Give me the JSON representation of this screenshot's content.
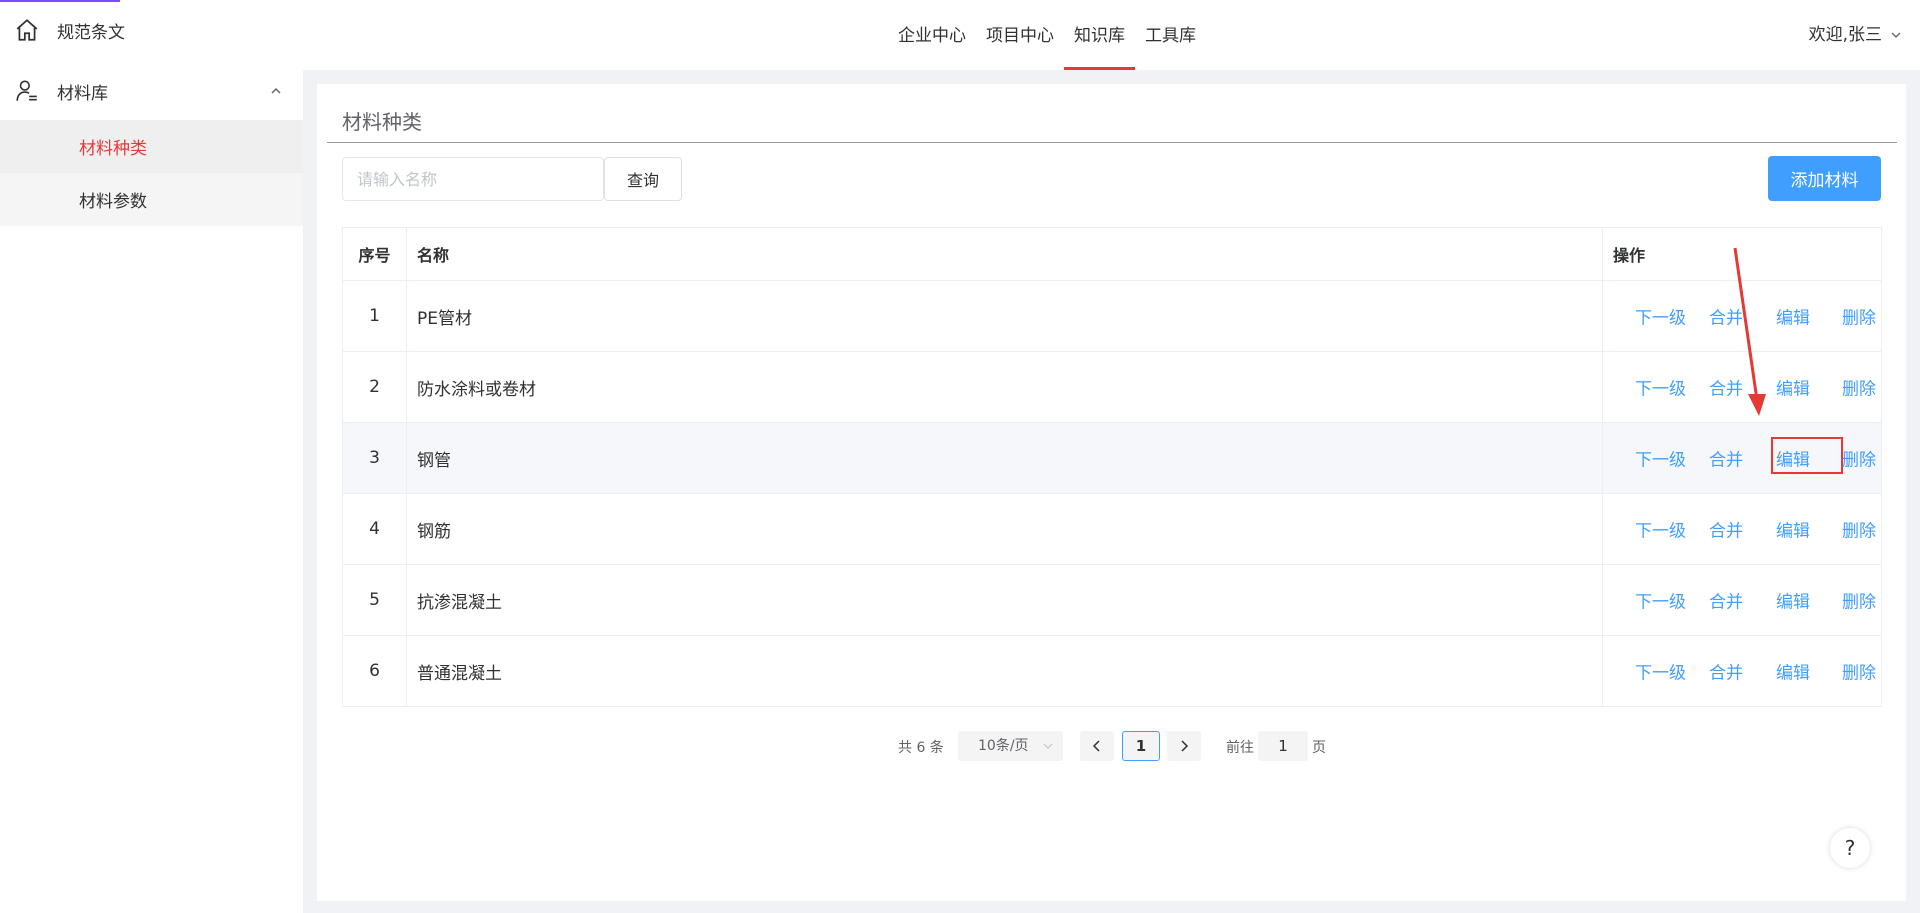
{
  "topnav": {
    "items": [
      {
        "label": "企业中心",
        "active": false
      },
      {
        "label": "项目中心",
        "active": false
      },
      {
        "label": "知识库",
        "active": true
      },
      {
        "label": "工具库",
        "active": false
      }
    ],
    "active_color": "#e4393c"
  },
  "user": {
    "greeting": "欢迎,张三"
  },
  "sidebar": {
    "items": [
      {
        "label": "规范条文",
        "icon": "home-icon"
      },
      {
        "label": "材料库",
        "icon": "user-list-icon",
        "expanded": true,
        "children": [
          {
            "label": "材料种类",
            "active": true
          },
          {
            "label": "材料参数",
            "active": false
          }
        ]
      }
    ]
  },
  "panel": {
    "title": "材料种类",
    "search": {
      "placeholder": "请输入名称",
      "value": ""
    },
    "query_label": "查询",
    "add_label": "添加材料"
  },
  "table": {
    "headers": {
      "no": "序号",
      "name": "名称",
      "op": "操作"
    },
    "actions": {
      "sub": "下一级",
      "merge": "合并",
      "edit": "编辑",
      "del": "删除"
    },
    "rows": [
      {
        "no": "1",
        "name": "PE管材"
      },
      {
        "no": "2",
        "name": "防水涂料或卷材"
      },
      {
        "no": "3",
        "name": "钢管"
      },
      {
        "no": "4",
        "name": "钢筋"
      },
      {
        "no": "5",
        "name": "抗渗混凝土"
      },
      {
        "no": "6",
        "name": "普通混凝土"
      }
    ],
    "hovered_row": 3,
    "highlighted_action": "edit"
  },
  "pagination": {
    "total": "共 6 条",
    "page_size": "10条/页",
    "current_page": "1",
    "goto_label": "前往",
    "goto_value": "1",
    "page_unit": "页"
  },
  "help": {
    "label": "?"
  },
  "colors": {
    "primary": "#409eff",
    "annotation": "#e53935"
  }
}
